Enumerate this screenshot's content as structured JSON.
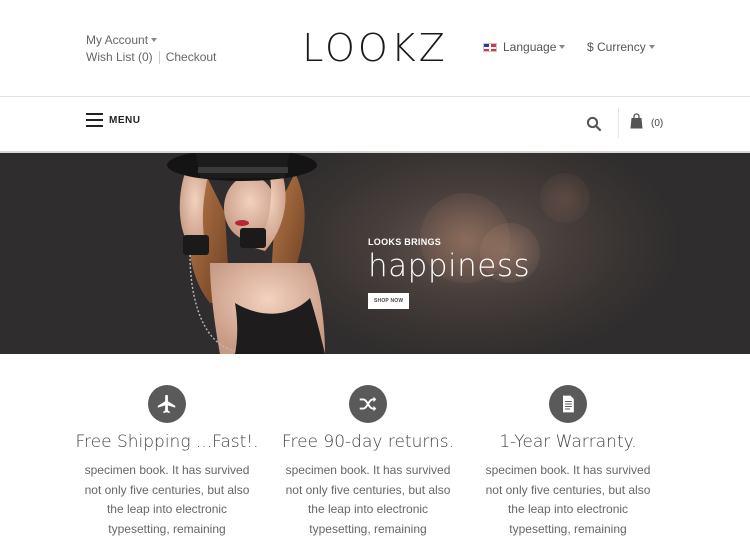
{
  "header": {
    "account_label": "My Account",
    "wishlist_label": "Wish List (0)",
    "checkout_label": "Checkout",
    "logo": "LOOKZ",
    "language_label": "Language",
    "currency_label": "$ Currency",
    "flag_icon": "uk-flag-icon"
  },
  "nav": {
    "menu_label": "MENU",
    "cart_count": "(0)",
    "icons": [
      "hamburger-icon",
      "search-icon",
      "shopping-bag-icon"
    ]
  },
  "hero": {
    "kicker": "LOOKS BRINGS",
    "title": "happiness",
    "button_label": "SHOP NOW"
  },
  "features": [
    {
      "icon": "airplane-icon",
      "title": "Free Shipping ...Fast!.",
      "text": "specimen book. It has survived not only five centuries, but also the leap into electronic typesetting, remaining"
    },
    {
      "icon": "shuffle-icon",
      "title": "Free 90-day returns.",
      "text": "specimen book. It has survived not only five centuries, but also the leap into electronic typesetting, remaining"
    },
    {
      "icon": "document-icon",
      "title": "1-Year Warranty.",
      "text": "specimen book. It has survived not only five centuries, but also the leap into electronic typesetting, remaining"
    }
  ],
  "colors": {
    "icon_circle": "#5a5a5a",
    "hero_bg": "#3a3533",
    "text": "#333333"
  }
}
